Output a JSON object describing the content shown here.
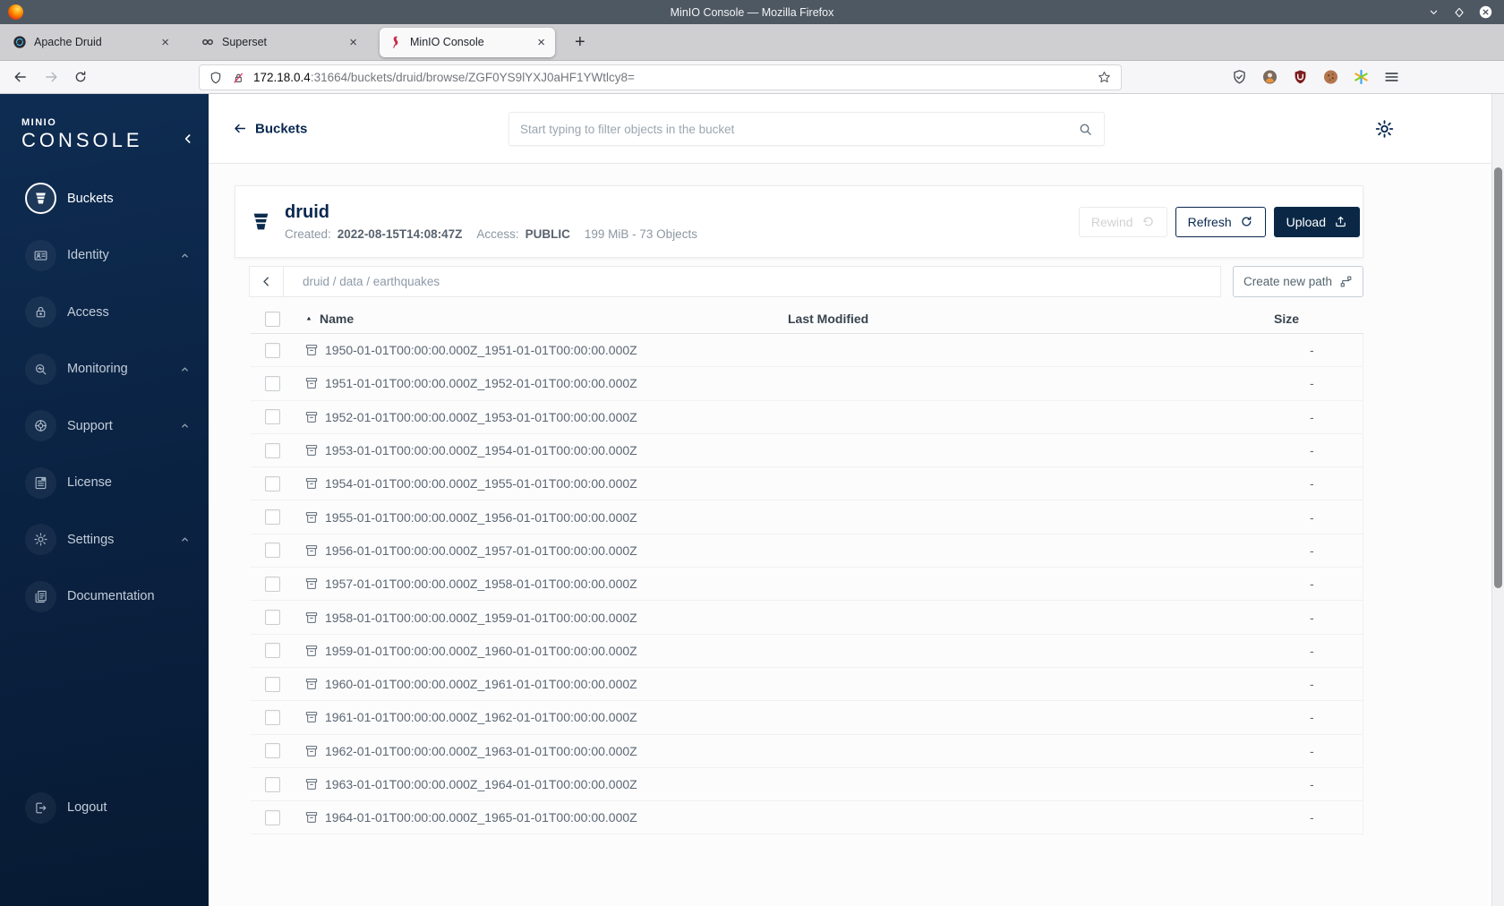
{
  "window": {
    "title": "MinIO Console — Mozilla Firefox"
  },
  "tabs": [
    {
      "label": "Apache Druid",
      "icon": "druid-favicon",
      "active": false
    },
    {
      "label": "Superset",
      "icon": "superset-favicon",
      "active": false
    },
    {
      "label": "MinIO Console",
      "icon": "minio-favicon",
      "active": true
    }
  ],
  "toolbar": {
    "url_domain": "172.18.0.4",
    "url_rest": ":31664/buckets/druid/browse/ZGF0YS9lYXJ0aHF1YWtlcy8="
  },
  "sidebar": {
    "logo_top": "MINIO",
    "logo_bottom": "CONSOLE",
    "items": [
      {
        "label": "Buckets",
        "icon": "buckets",
        "active": true,
        "chevron": false
      },
      {
        "label": "Identity",
        "icon": "identity",
        "active": false,
        "chevron": true
      },
      {
        "label": "Access",
        "icon": "access",
        "active": false,
        "chevron": false
      },
      {
        "label": "Monitoring",
        "icon": "monitoring",
        "active": false,
        "chevron": true
      },
      {
        "label": "Support",
        "icon": "support",
        "active": false,
        "chevron": true
      },
      {
        "label": "License",
        "icon": "license",
        "active": false,
        "chevron": false
      },
      {
        "label": "Settings",
        "icon": "settings",
        "active": false,
        "chevron": true
      },
      {
        "label": "Documentation",
        "icon": "documentation",
        "active": false,
        "chevron": false
      }
    ],
    "logout_label": "Logout"
  },
  "header": {
    "back_label": "Buckets",
    "search_placeholder": "Start typing to filter objects in the bucket"
  },
  "bucket": {
    "name": "druid",
    "created_label": "Created:",
    "created_value": "2022-08-15T14:08:47Z",
    "access_label": "Access:",
    "access_value": "PUBLIC",
    "stats": "199 MiB - 73 Objects",
    "rewind_label": "Rewind",
    "refresh_label": "Refresh",
    "upload_label": "Upload"
  },
  "browser": {
    "path_segments": [
      "druid",
      "data",
      "earthquakes"
    ],
    "path_display": "druid / data / earthquakes",
    "create_path_label": "Create new path"
  },
  "table": {
    "headers": [
      "Name",
      "Last Modified",
      "Size"
    ],
    "rows": [
      {
        "name": "1950-01-01T00:00:00.000Z_1951-01-01T00:00:00.000Z",
        "modified": "",
        "size": "-"
      },
      {
        "name": "1951-01-01T00:00:00.000Z_1952-01-01T00:00:00.000Z",
        "modified": "",
        "size": "-"
      },
      {
        "name": "1952-01-01T00:00:00.000Z_1953-01-01T00:00:00.000Z",
        "modified": "",
        "size": "-"
      },
      {
        "name": "1953-01-01T00:00:00.000Z_1954-01-01T00:00:00.000Z",
        "modified": "",
        "size": "-"
      },
      {
        "name": "1954-01-01T00:00:00.000Z_1955-01-01T00:00:00.000Z",
        "modified": "",
        "size": "-"
      },
      {
        "name": "1955-01-01T00:00:00.000Z_1956-01-01T00:00:00.000Z",
        "modified": "",
        "size": "-"
      },
      {
        "name": "1956-01-01T00:00:00.000Z_1957-01-01T00:00:00.000Z",
        "modified": "",
        "size": "-"
      },
      {
        "name": "1957-01-01T00:00:00.000Z_1958-01-01T00:00:00.000Z",
        "modified": "",
        "size": "-"
      },
      {
        "name": "1958-01-01T00:00:00.000Z_1959-01-01T00:00:00.000Z",
        "modified": "",
        "size": "-"
      },
      {
        "name": "1959-01-01T00:00:00.000Z_1960-01-01T00:00:00.000Z",
        "modified": "",
        "size": "-"
      },
      {
        "name": "1960-01-01T00:00:00.000Z_1961-01-01T00:00:00.000Z",
        "modified": "",
        "size": "-"
      },
      {
        "name": "1961-01-01T00:00:00.000Z_1962-01-01T00:00:00.000Z",
        "modified": "",
        "size": "-"
      },
      {
        "name": "1962-01-01T00:00:00.000Z_1963-01-01T00:00:00.000Z",
        "modified": "",
        "size": "-"
      },
      {
        "name": "1963-01-01T00:00:00.000Z_1964-01-01T00:00:00.000Z",
        "modified": "",
        "size": "-"
      },
      {
        "name": "1964-01-01T00:00:00.000Z_1965-01-01T00:00:00.000Z",
        "modified": "",
        "size": "-"
      }
    ]
  },
  "colors": {
    "accent_navy": "#07274f",
    "sidebar_top": "#0e2c52",
    "sidebar_bottom": "#071a33",
    "upload_button_bg": "#0a2846",
    "titlebar": "#4e5862"
  }
}
